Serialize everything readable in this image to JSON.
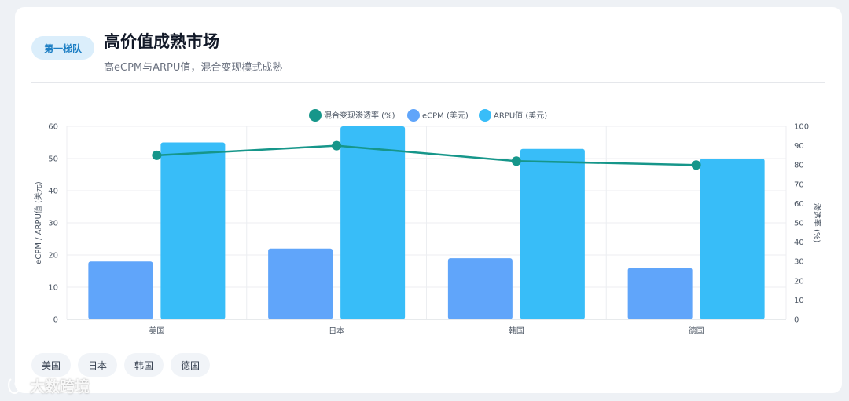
{
  "header": {
    "badge": "第一梯队",
    "title": "高价值成熟市场",
    "subtitle": "高eCPM与ARPU值，混合变现模式成熟"
  },
  "tags": [
    "美国",
    "日本",
    "韩国",
    "德国"
  ],
  "watermark": {
    "text": "大数跨境"
  },
  "colors": {
    "line": "#16968a",
    "ecpm": "#60a5fa",
    "arpu": "#38bdf8",
    "badge_bg": "#dbeefb",
    "badge_text": "#1d7fc4"
  },
  "chart_data": {
    "type": "bar",
    "categories": [
      "美国",
      "日本",
      "韩国",
      "德国"
    ],
    "series": [
      {
        "name": "混合变现渗透率 (%)",
        "type": "line",
        "axis": "right",
        "values": [
          85,
          90,
          82,
          80
        ]
      },
      {
        "name": "eCPM (美元)",
        "type": "bar",
        "axis": "left",
        "values": [
          18,
          22,
          19,
          16
        ]
      },
      {
        "name": "ARPU值 (美元)",
        "type": "bar",
        "axis": "left",
        "values": [
          55,
          60,
          53,
          50
        ]
      }
    ],
    "ylabel": "eCPM / ARPU值 (美元)",
    "ylabel_right": "渗透率 (%)",
    "ylim": [
      0,
      60
    ],
    "yticks": [
      0,
      10,
      20,
      30,
      40,
      50,
      60
    ],
    "ylim_right": [
      0,
      100
    ],
    "yticks_right": [
      0,
      10,
      20,
      30,
      40,
      50,
      60,
      70,
      80,
      90,
      100
    ],
    "legend_position": "top-center",
    "grid": true
  }
}
